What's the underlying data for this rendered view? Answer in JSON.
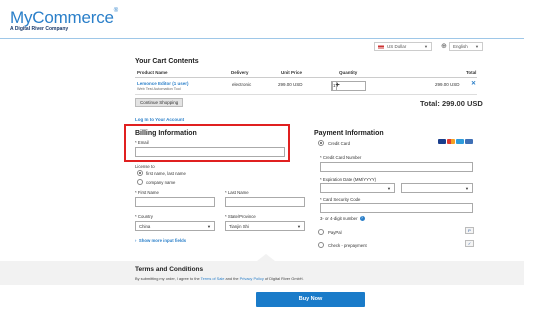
{
  "brand": {
    "name": "MyCommerce",
    "reg": "®",
    "sub": "A Digital River Company"
  },
  "selectors": {
    "currency": "US Dollar",
    "language": "English"
  },
  "cart": {
    "title": "Your Cart Contents",
    "columns": [
      "Product Name",
      "Delivery",
      "Unit Price",
      "Quantity",
      "Total"
    ],
    "items": [
      {
        "name": "Lemonce Editor (1 user)",
        "subtitle": "Web Test Automation Tool",
        "delivery": "electronic",
        "unit_price": "299.00 USD",
        "quantity": "1",
        "total": "299.00 USD"
      }
    ],
    "continue_label": "Continue Shopping",
    "total_label": "Total:",
    "total_value": "299.00 USD"
  },
  "login_link": "Log In to Your Account",
  "billing": {
    "title": "Billing Information",
    "email_label": "* Email",
    "email_value": "",
    "license_label": "License to",
    "license_options": [
      "first name, last name",
      "company name"
    ],
    "first_name_label": "* First Name",
    "last_name_label": "* Last Name",
    "country_label": "* Country",
    "country_value": "China",
    "state_label": "* State/Province",
    "state_value": "Tianjin Shi",
    "more_link": "Show more input fields"
  },
  "payment": {
    "title": "Payment Information",
    "credit_card_label": "Credit Card",
    "card_number_label": "* Credit Card Number",
    "expiration_label": "* Expiration Date (MM/YYYY)",
    "security_code_label": "* Card Security Code",
    "digits_label": "3- or 4-digit number",
    "paypal_label": "PayPal",
    "check_label": "Check - prepayment"
  },
  "terms": {
    "title": "Terms and Conditions",
    "text_before": "By submitting my order, I agree to the ",
    "link1": "Terms of Sale",
    "text_mid": " and the ",
    "link2": "Privacy Policy",
    "text_after": " of Digital River GmbH."
  },
  "buy_label": "Buy Now",
  "colors": {
    "accent": "#2a7fc9",
    "highlight": "#e02020",
    "buy_button": "#1a7bc9"
  }
}
